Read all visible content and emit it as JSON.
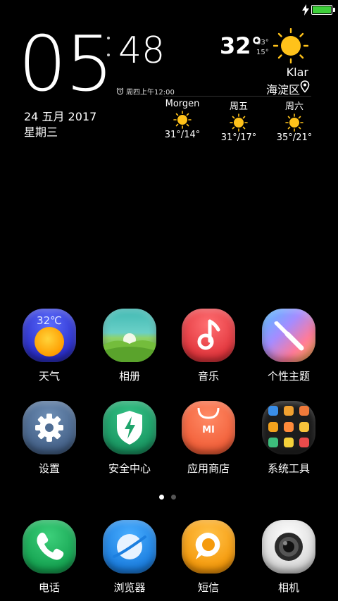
{
  "clock": {
    "hours": "05",
    "minutes": "48",
    "alarm": "周四上午12:00"
  },
  "date": {
    "date": "24 五月 2017",
    "weekday": "星期三"
  },
  "weather": {
    "temp_now": "32°",
    "temp_high": "33°",
    "temp_low": "15°",
    "condition": "Klar",
    "location": "海淀区",
    "forecast": [
      {
        "day": "Morgen",
        "range": "31°/14°"
      },
      {
        "day": "周五",
        "range": "31°/17°"
      },
      {
        "day": "周六",
        "range": "35°/21°"
      }
    ]
  },
  "apps_row1": [
    {
      "label": "天气",
      "icon": "weather-icon",
      "badge": "32℃"
    },
    {
      "label": "相册",
      "icon": "gallery-icon"
    },
    {
      "label": "音乐",
      "icon": "music-icon"
    },
    {
      "label": "个性主题",
      "icon": "themes-icon"
    }
  ],
  "apps_row2": [
    {
      "label": "设置",
      "icon": "settings-icon"
    },
    {
      "label": "安全中心",
      "icon": "security-icon"
    },
    {
      "label": "应用商店",
      "icon": "app-store-icon",
      "badge": "MI"
    },
    {
      "label": "系统工具",
      "icon": "system-tools-folder-icon"
    }
  ],
  "dock": [
    {
      "label": "电话",
      "icon": "phone-icon"
    },
    {
      "label": "浏览器",
      "icon": "browser-icon"
    },
    {
      "label": "短信",
      "icon": "messages-icon"
    },
    {
      "label": "相机",
      "icon": "camera-icon"
    }
  ],
  "page_indicator": {
    "count": 2,
    "active": 1
  },
  "colors": {
    "battery": "#3ecf3a",
    "sun": "#ffc21a"
  }
}
